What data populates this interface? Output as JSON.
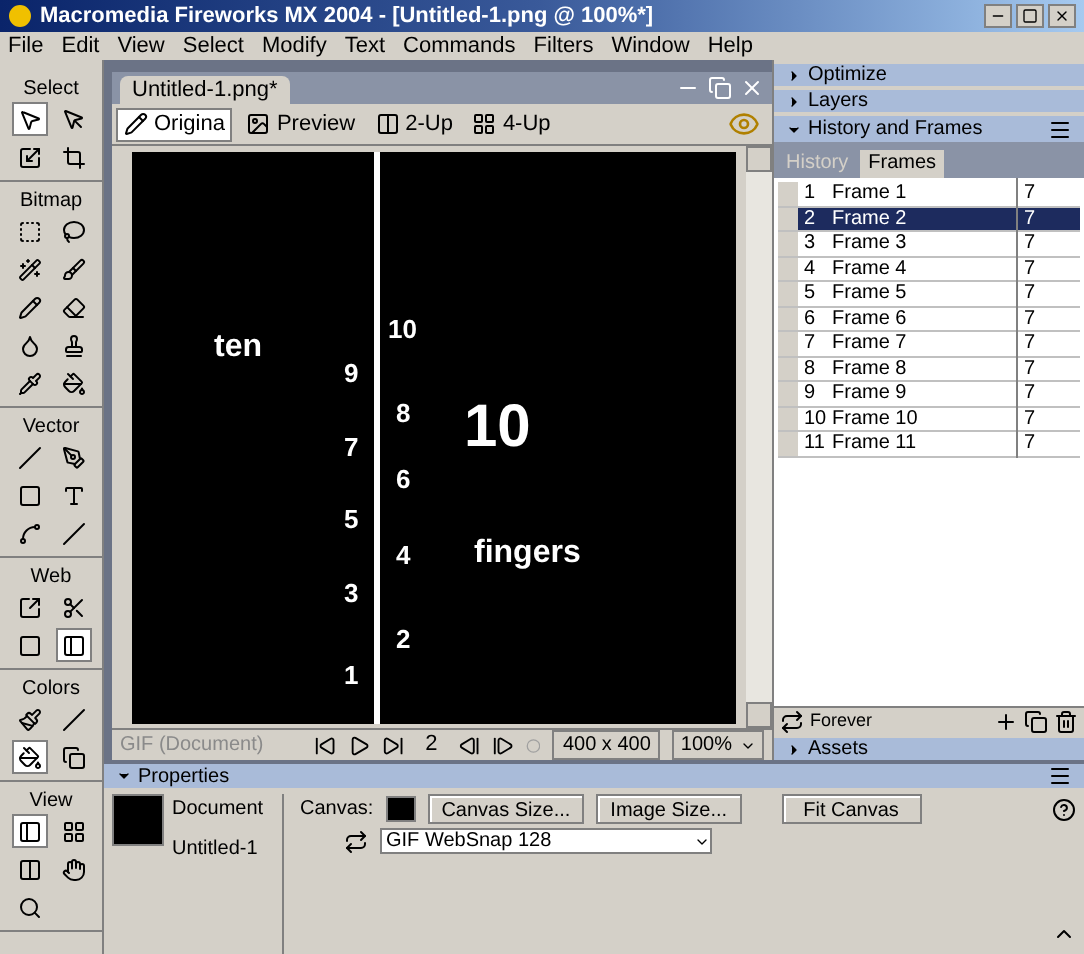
{
  "window": {
    "title": "Macromedia Fireworks MX 2004 - [Untitled-1.png @ 100%*]"
  },
  "menu": [
    "File",
    "Edit",
    "View",
    "Select",
    "Modify",
    "Text",
    "Commands",
    "Filters",
    "Window",
    "Help"
  ],
  "tool_sections": [
    {
      "label": "Select",
      "tools": [
        {
          "selected": true
        },
        {
          "selected": false
        },
        {
          "selected": false
        },
        {
          "selected": false
        }
      ]
    },
    {
      "label": "Bitmap",
      "tools": [
        {
          "selected": false
        },
        {
          "selected": false
        },
        {
          "selected": false
        },
        {
          "selected": false
        },
        {
          "selected": false
        },
        {
          "selected": false
        },
        {
          "selected": false
        },
        {
          "selected": false
        },
        {
          "selected": false
        },
        {
          "selected": false
        }
      ]
    },
    {
      "label": "Vector",
      "tools": [
        {
          "selected": false
        },
        {
          "selected": false
        },
        {
          "selected": false
        },
        {
          "selected": false
        },
        {
          "selected": false
        },
        {
          "selected": false
        }
      ]
    },
    {
      "label": "Web",
      "tools": [
        {
          "selected": false
        },
        {
          "selected": false
        },
        {
          "selected": false
        },
        {
          "selected": true
        }
      ]
    },
    {
      "label": "Colors",
      "tools": [
        {
          "selected": false
        },
        {
          "selected": false
        },
        {
          "selected": true
        },
        {
          "selected": false
        }
      ]
    },
    {
      "label": "View",
      "tools": [
        {
          "selected": true
        },
        {
          "selected": false
        },
        {
          "selected": false
        },
        {
          "selected": false
        },
        {
          "selected": false
        }
      ]
    }
  ],
  "document": {
    "tab": "Untitled-1.png*",
    "views": [
      {
        "label": "Origina",
        "selected": true
      },
      {
        "label": "Preview",
        "selected": false
      },
      {
        "label": "2-Up",
        "selected": false
      },
      {
        "label": "4-Up",
        "selected": false
      }
    ],
    "canvas_texts": [
      {
        "text": "ten",
        "kind": "word"
      },
      {
        "text": "9",
        "kind": "small"
      },
      {
        "text": "7",
        "kind": "small"
      },
      {
        "text": "5",
        "kind": "small"
      },
      {
        "text": "3",
        "kind": "small"
      },
      {
        "text": "1",
        "kind": "small"
      },
      {
        "text": "10",
        "kind": "small"
      },
      {
        "text": "8",
        "kind": "small"
      },
      {
        "text": "6",
        "kind": "small"
      },
      {
        "text": "4",
        "kind": "small"
      },
      {
        "text": "2",
        "kind": "small"
      },
      {
        "text": "10",
        "kind": "large"
      },
      {
        "text": "fingers",
        "kind": "word"
      }
    ],
    "status": {
      "format": "GIF (Document)",
      "frame": "2",
      "size": "400 x 400",
      "zoom": "100%"
    }
  },
  "panels": {
    "collapsed_top": [
      "Optimize",
      "Layers"
    ],
    "history_frames": {
      "title": "History and Frames",
      "tabs": [
        {
          "label": "History",
          "selected": false
        },
        {
          "label": "Frames",
          "selected": true
        }
      ],
      "frames": [
        {
          "number": "1",
          "name": "Frame 1",
          "delay": "7",
          "selected": false
        },
        {
          "number": "2",
          "name": "Frame 2",
          "delay": "7",
          "selected": true
        },
        {
          "number": "3",
          "name": "Frame 3",
          "delay": "7",
          "selected": false
        },
        {
          "number": "4",
          "name": "Frame 4",
          "delay": "7",
          "selected": false
        },
        {
          "number": "5",
          "name": "Frame 5",
          "delay": "7",
          "selected": false
        },
        {
          "number": "6",
          "name": "Frame 6",
          "delay": "7",
          "selected": false
        },
        {
          "number": "7",
          "name": "Frame 7",
          "delay": "7",
          "selected": false
        },
        {
          "number": "8",
          "name": "Frame 8",
          "delay": "7",
          "selected": false
        },
        {
          "number": "9",
          "name": "Frame 9",
          "delay": "7",
          "selected": false
        },
        {
          "number": "10",
          "name": "Frame 10",
          "delay": "7",
          "selected": false
        },
        {
          "number": "11",
          "name": "Frame 11",
          "delay": "7",
          "selected": false
        }
      ],
      "loop": "Forever"
    },
    "collapsed_bottom": [
      "Assets"
    ]
  },
  "properties": {
    "title": "Properties",
    "kind_label": "Document",
    "name": "Untitled-1",
    "canvas_label": "Canvas:",
    "buttons": [
      "Canvas Size...",
      "Image Size...",
      "Fit Canvas"
    ],
    "palette": "GIF WebSnap 128"
  }
}
